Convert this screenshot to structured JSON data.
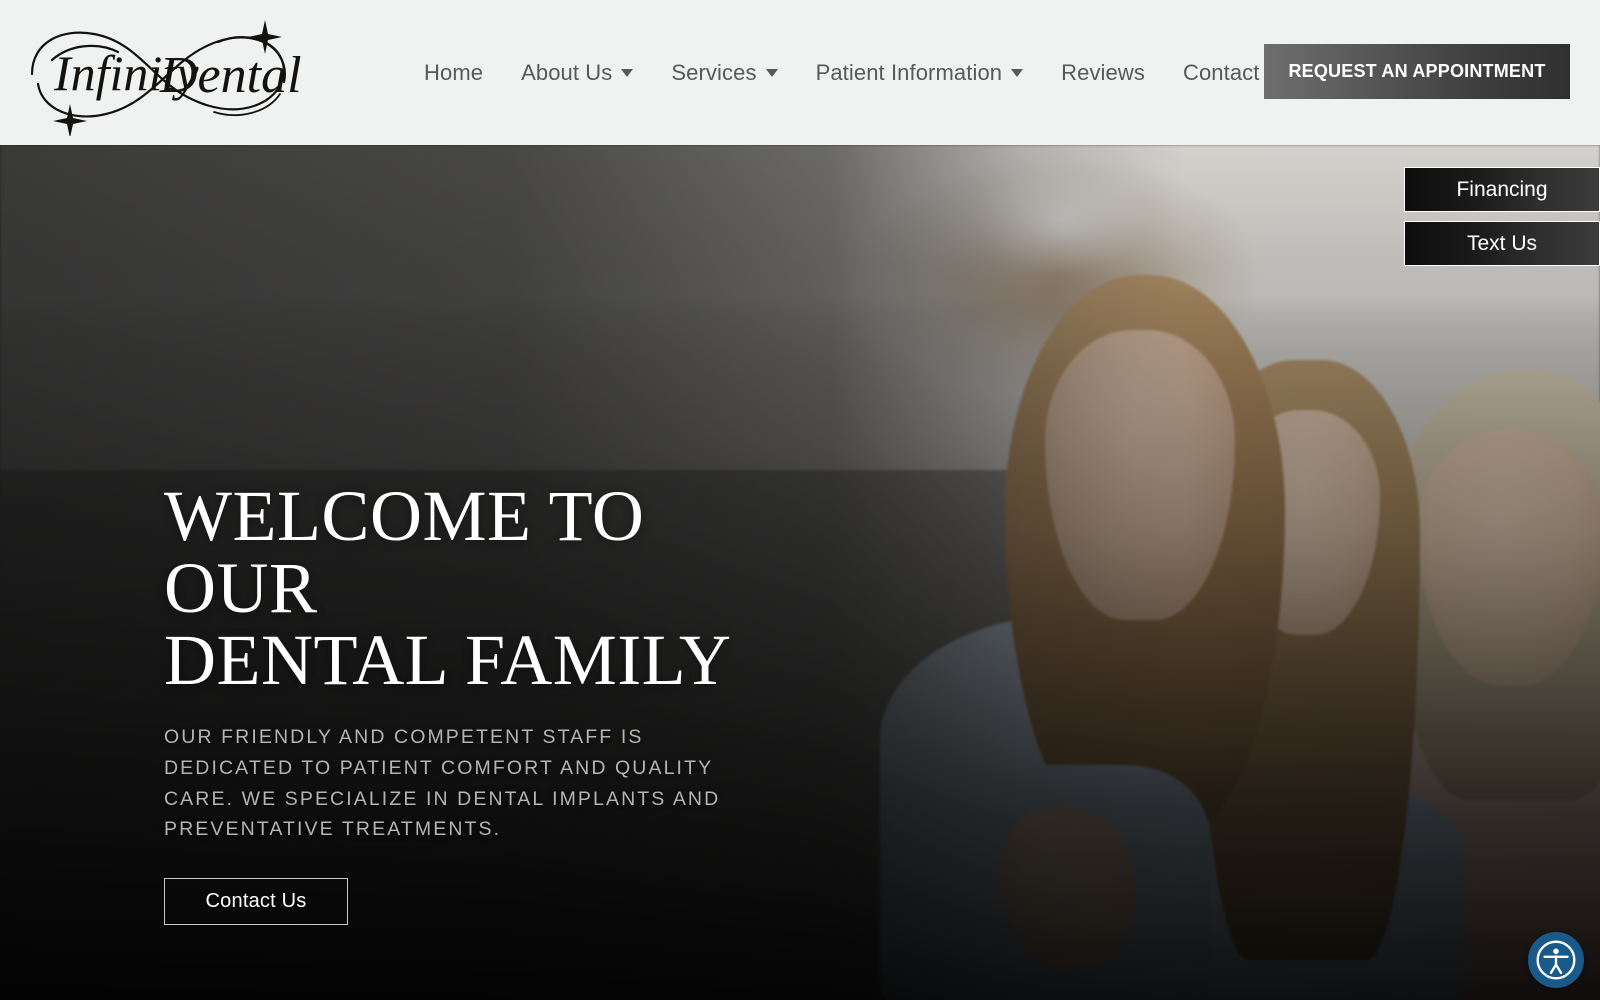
{
  "site": {
    "brand_name": "Infinity Dental",
    "logo_icon": "infinity-script-logo"
  },
  "header": {
    "background_color": "#eff2f1",
    "nav_items": [
      {
        "label": "Home",
        "has_dropdown": false
      },
      {
        "label": "About Us",
        "has_dropdown": true
      },
      {
        "label": "Services",
        "has_dropdown": true
      },
      {
        "label": "Patient Information",
        "has_dropdown": true
      },
      {
        "label": "Reviews",
        "has_dropdown": false
      },
      {
        "label": "Contact",
        "has_dropdown": false
      }
    ],
    "appointment_button": {
      "label": "REQUEST AN APPOINTMENT",
      "text_color": "#ffffff"
    }
  },
  "hero": {
    "title_line1": "WELCOME TO OUR",
    "title_line2": "DENTAL FAMILY",
    "subtitle": "OUR FRIENDLY AND COMPETENT STAFF IS DEDICATED TO PATIENT COMFORT AND QUALITY CARE. WE SPECIALIZE IN DENTAL IMPLANTS AND PREVENTATIVE TREATMENTS.",
    "cta_label": "Contact Us",
    "title_color": "#ffffff",
    "subtitle_color": "#b3b4b3",
    "image_description": "Three generations of smiling women seated on a gray sofa in a bright living room"
  },
  "side_tabs": [
    {
      "label": "Financing"
    },
    {
      "label": "Text Us"
    }
  ],
  "accessibility_widget": {
    "icon": "accessibility-person-icon",
    "color": "#1a5a8a"
  }
}
